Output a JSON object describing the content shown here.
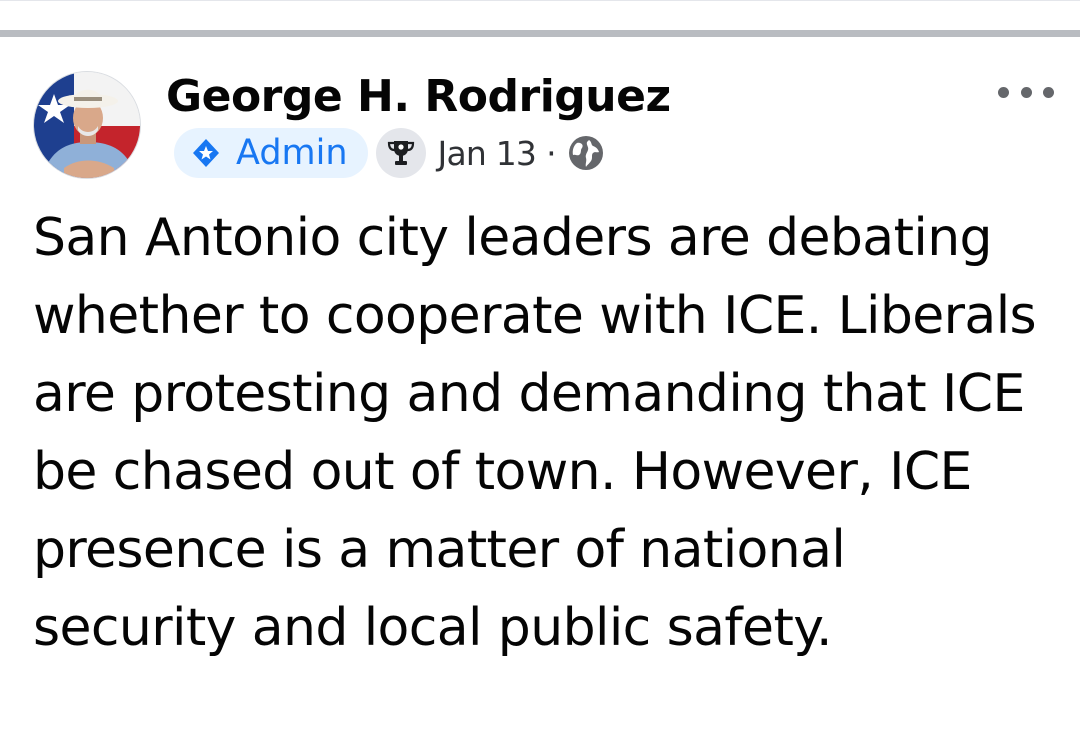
{
  "post": {
    "author_name": "George H. Rodriguez",
    "role_badge": "Admin",
    "date": "Jan 13",
    "separator": "·",
    "body": "San Antonio city leaders are debating whether to cooperate with ICE. Liberals are protesting and demanding that ICE be chased out of town. However, ICE presence is a matter of national security and local public safety.",
    "icons": {
      "role": "admin-shield-icon",
      "achievement": "trophy-icon",
      "audience": "globe-public-icon",
      "menu": "more-options-icon"
    },
    "colors": {
      "badge_text": "#1877f2",
      "badge_bg": "#e7f3ff",
      "text": "#050505",
      "meta_text": "#303236"
    }
  }
}
